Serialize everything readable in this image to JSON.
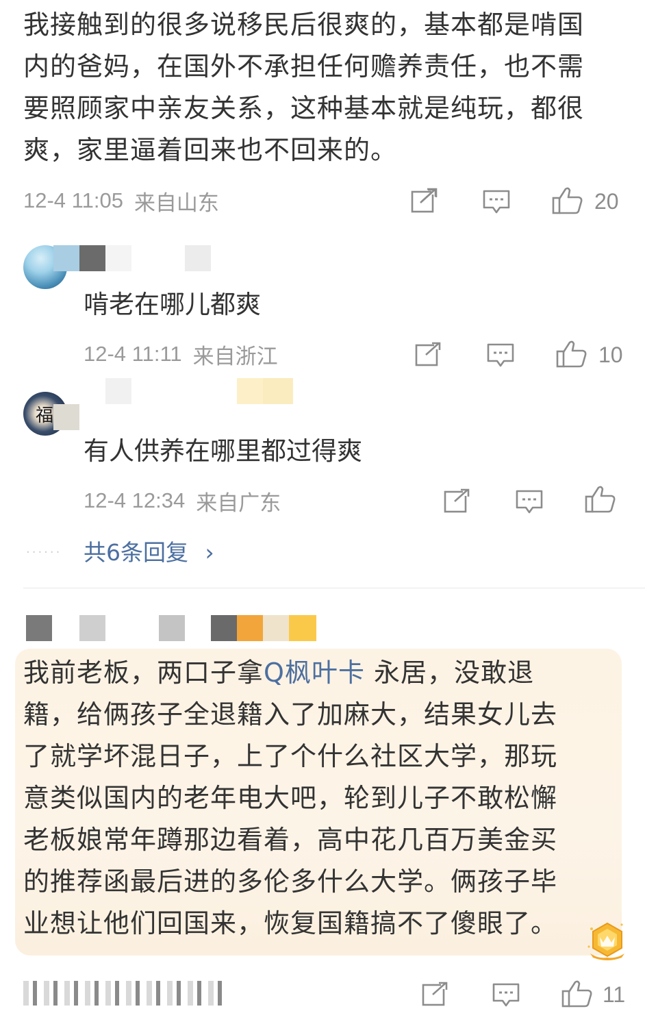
{
  "comments": [
    {
      "text": "我接触到的很多说移民后很爽的，基本都是啃国内的爸妈，在国外不承担任何赡养责任，也不需要照顾家中亲友关系，这种基本就是纯玩，都很爽，家里逼着回来也不回来的。",
      "lines": [
        "我接触到的很多说移民后很爽的，基本都是啃国",
        "内的爸妈，在国外不承担任何赡养责任，也不需",
        "要照顾家中亲友关系，这种基本就是纯玩，都很",
        "爽，家里逼着回来也不回来的。"
      ],
      "timestamp": "12-4 11:05",
      "location": "来自山东",
      "like_count": "20"
    }
  ],
  "replies": [
    {
      "text": "啃老在哪儿都爽",
      "timestamp": "12-4 11:11",
      "location": "来自浙江",
      "like_count": "10"
    },
    {
      "text": "有人供养在哪里都过得爽",
      "timestamp": "12-4 12:34",
      "location": "来自广东",
      "like_count": ""
    }
  ],
  "more_replies": {
    "dots": "······",
    "label": "共6条回复",
    "chevron": "›"
  },
  "second_comment": {
    "line1_before": "我前老板，两口子拿",
    "topic_icon": "Q",
    "topic": "枫叶卡",
    "line1_after": " 永居，没敢退",
    "lines": [
      "籍，给俩孩子全退籍入了加麻大，结果女儿去",
      "了就学坏混日子，上了个什么社区大学，那玩",
      "意类似国内的老年电大吧，轮到儿子不敢松懈",
      "老板娘常年蹲那边看着，高中花几百万美金买",
      "的推荐函最后进的多伦多什么大学。俩孩子毕",
      "业想让他们回国来，恢复国籍搞不了傻眼了。"
    ],
    "like_count": "11"
  },
  "icons": {
    "share": "share-icon",
    "comment": "comment-icon",
    "like": "thumbs-up-icon",
    "badge": "crown-badge-icon"
  },
  "colors": {
    "link": "#4c6fa0",
    "meta": "#9a9a9a",
    "highlight_bg": "#fdf3e4"
  }
}
